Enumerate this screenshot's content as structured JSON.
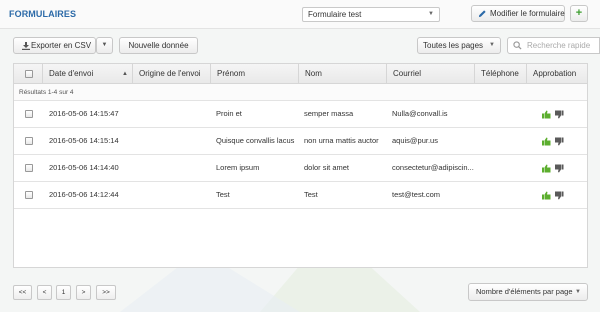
{
  "header": {
    "title": "FORMULAIRES",
    "form_select": "Formulaire test",
    "edit_button": "Modifier le formulaire",
    "add_button": "+"
  },
  "toolbar": {
    "export_button": "Exporter en CSV",
    "new_button": "Nouvelle donnée",
    "pages_select": "Toutes les pages",
    "search_placeholder": "Recherche rapide"
  },
  "table": {
    "columns": [
      "Date d'envoi",
      "Origine de l'envoi",
      "Prénom",
      "Nom",
      "Courriel",
      "Téléphone",
      "Approbation"
    ],
    "summary": "Résultats 1-4 sur 4",
    "rows": [
      {
        "date": "2016-05-06 14:15:47",
        "origin": "",
        "prenom": "Proin et",
        "nom": "semper massa",
        "courriel": "Nulla@convall.is",
        "telephone": ""
      },
      {
        "date": "2016-05-06 14:15:14",
        "origin": "",
        "prenom": "Quisque convallis lacus",
        "nom": "non urna mattis auctor",
        "courriel": "aquis@pur.us",
        "telephone": ""
      },
      {
        "date": "2016-05-06 14:14:40",
        "origin": "",
        "prenom": "Lorem ipsum",
        "nom": "dolor sit amet",
        "courriel": "consectetur@adipiscin...",
        "telephone": ""
      },
      {
        "date": "2016-05-06 14:12:44",
        "origin": "",
        "prenom": "Test",
        "nom": "Test",
        "courriel": "test@test.com",
        "telephone": ""
      }
    ]
  },
  "pagination": {
    "first": "<<",
    "prev": "<",
    "current": "1",
    "next": ">",
    "last": ">>",
    "per_page": "Nombre d'éléments par page"
  },
  "colors": {
    "title": "#2c6aa8",
    "approve": "#5cae2e",
    "reject": "#5a5a5a"
  },
  "icons": [
    "pencil-icon",
    "plus-icon",
    "download-icon",
    "chevron-down-icon",
    "search-icon",
    "sort-up-icon",
    "thumbs-up-icon",
    "thumbs-down-icon"
  ]
}
